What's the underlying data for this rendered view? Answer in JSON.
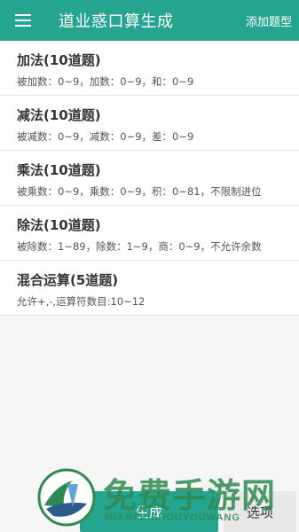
{
  "app_bar": {
    "title": "道业惑口算生成",
    "add_label": "添加题型",
    "menu_icon": "hamburger-menu-icon",
    "background": "#25a48f"
  },
  "items": [
    {
      "title": "加法(10道题)",
      "desc": "被加数：0~9，加数：0~9，和：0~9"
    },
    {
      "title": "减法(10道题)",
      "desc": "被减数：0~9，减数：0~9，差：0~9"
    },
    {
      "title": "乘法(10道题)",
      "desc": "被乘数：0~9，乘数：0~9，积：0~81，不限制进位"
    },
    {
      "title": "除法(10道题)",
      "desc": "被除数：1~89，除数：1~9，商：0~9，不允许余数"
    },
    {
      "title": "混合运算(5道题)",
      "desc": "允许+,-,运算符数目:10~12"
    }
  ],
  "bottom": {
    "generate_label": "生成",
    "options_label": "选项"
  },
  "watermark": {
    "text": "免费手游网",
    "sub": "MIANFEISHOUYOUWANG"
  }
}
